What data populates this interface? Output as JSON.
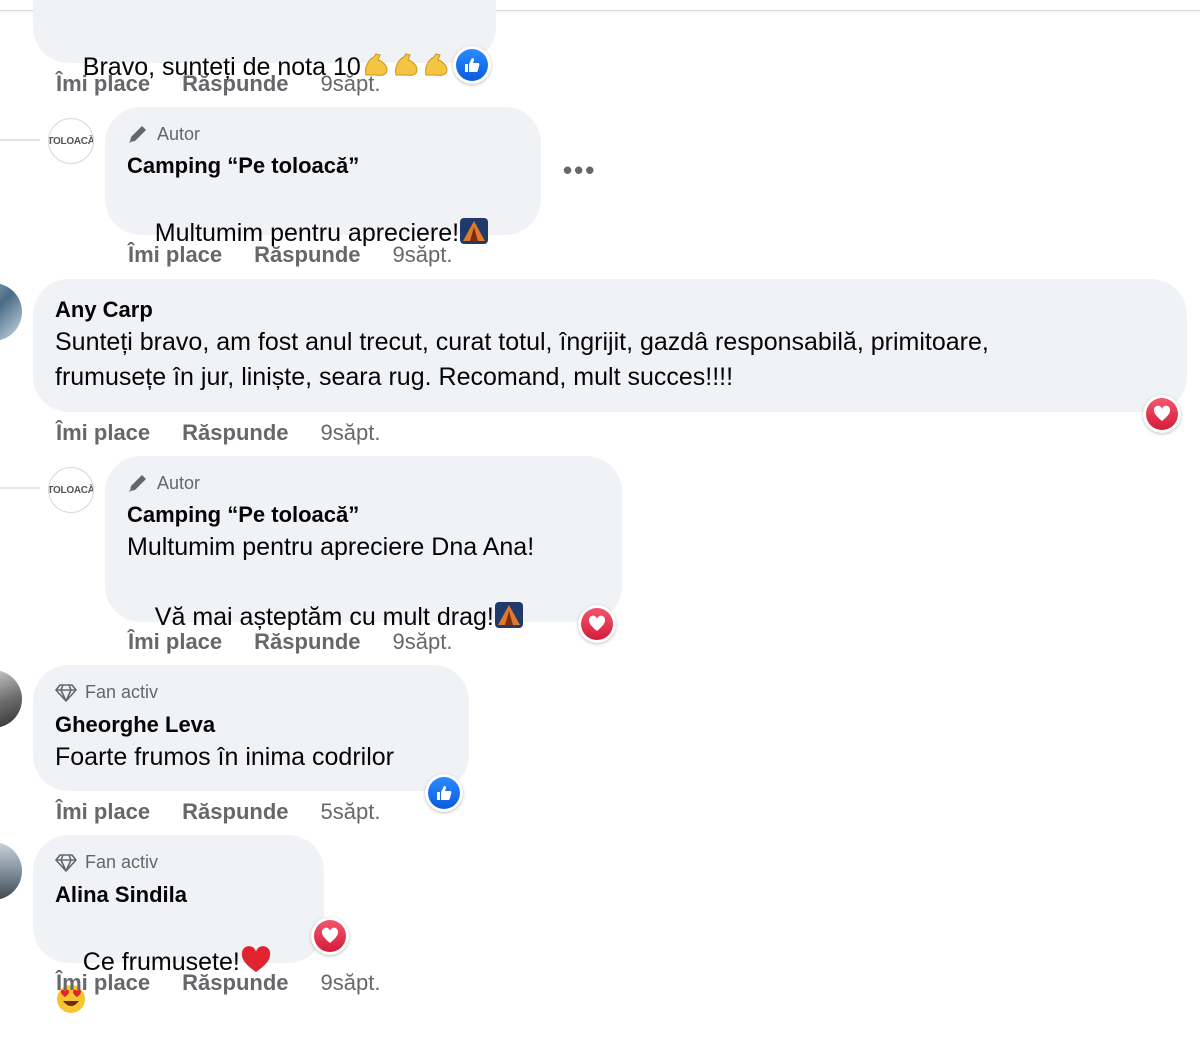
{
  "comments": [
    {
      "text": "Bravo, sunteți de nota 10",
      "emoji": [
        "flexed-biceps",
        "flexed-biceps",
        "flexed-biceps"
      ],
      "reaction": "like",
      "actions": {
        "like": "Îmi place",
        "reply": "Răspunde",
        "time": "9săpt."
      }
    },
    {
      "badge": "Autor",
      "author": "Camping “Pe toloacă”",
      "avatar_text": "TOLOACĂ",
      "text": "Multumim pentru apreciere!",
      "emoji": [
        "tent-night"
      ],
      "more": "•••",
      "actions": {
        "like": "Îmi place",
        "reply": "Răspunde",
        "time": "9săpt."
      }
    },
    {
      "author": "Any Carp",
      "text_line1": "Sunteți bravo, am fost anul trecut, curat totul, îngrijit, gazdâ responsabilă, primitoare,",
      "text_line2": "frumusețe în jur, liniște, seara rug. Recomand, mult succes!!!!",
      "reaction": "love",
      "actions": {
        "like": "Îmi place",
        "reply": "Răspunde",
        "time": "9săpt."
      }
    },
    {
      "badge": "Autor",
      "author": "Camping “Pe toloacă”",
      "avatar_text": "TOLOACĂ",
      "text_line1": "Multumim pentru apreciere Dna Ana!",
      "text_line2": "Vă mai așteptăm cu mult drag!",
      "emoji": [
        "tent-night"
      ],
      "reaction": "love",
      "actions": {
        "like": "Îmi place",
        "reply": "Răspunde",
        "time": "9săpt."
      }
    },
    {
      "badge": "Fan activ",
      "author": "Gheorghe Leva",
      "text": "Foarte frumos în inima codrilor",
      "reaction": "like",
      "actions": {
        "like": "Îmi place",
        "reply": "Răspunde",
        "time": "5săpt."
      }
    },
    {
      "badge": "Fan activ",
      "author": "Alina Sindila",
      "text": "Ce frumusete!",
      "emoji": [
        "red-heart",
        "heart-eyes"
      ],
      "reaction": "love",
      "actions": {
        "like": "Îmi place",
        "reply": "Răspunde",
        "time": "9săpt."
      }
    }
  ],
  "colors": {
    "bubble": "#f0f2f5",
    "meta": "#65676b",
    "like": "#1877f2",
    "love": "#e41e3f"
  }
}
